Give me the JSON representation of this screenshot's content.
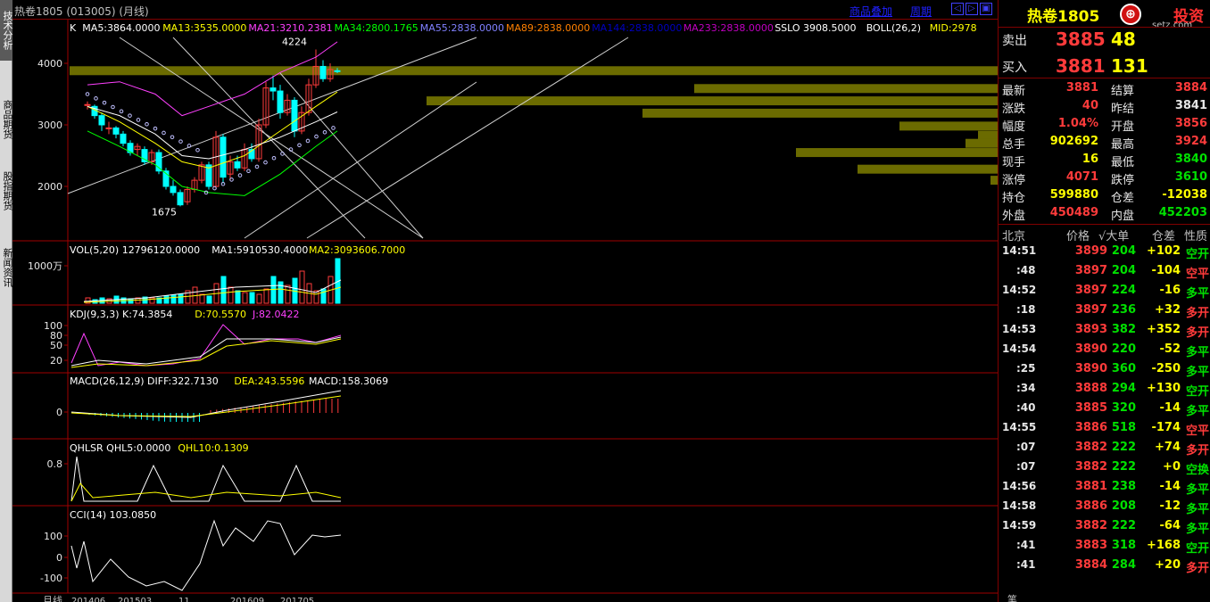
{
  "window": {
    "title": "热卷1805 (013005) (月线)"
  },
  "toolbar": {
    "overlay_label": "商品叠加",
    "period_label": "周期",
    "btn_prev": "◁",
    "btn_next": "▷",
    "btn_close": "▣"
  },
  "side_tabs": [
    {
      "label": "技术分析",
      "active": true
    },
    {
      "label": "商品期货",
      "active": false
    },
    {
      "label": "股指期货",
      "active": false
    },
    {
      "label": "新闻资讯",
      "active": false
    }
  ],
  "kline": {
    "legend": [
      {
        "text": "K",
        "color": "#ffffff"
      },
      {
        "text": "MA5:3864.0000",
        "color": "#ffffff"
      },
      {
        "text": "MA13:3535.0000",
        "color": "#ffff00"
      },
      {
        "text": "MA21:3210.2381",
        "color": "#ff40ff"
      },
      {
        "text": "MA34:2800.1765",
        "color": "#00ff00"
      },
      {
        "text": "MA55:2838.0000",
        "color": "#8080ff"
      },
      {
        "text": "MA89:2838.0000",
        "color": "#ff8000"
      },
      {
        "text": "MA144:2838.0000",
        "color": "#0000c0"
      },
      {
        "text": "MA233:2838.0000",
        "color": "#c000c0"
      },
      {
        "text": "SSLO  3908.5000",
        "color": "#ffffff"
      },
      {
        "text": "BOLL(26,2)",
        "color": "#ffffff"
      },
      {
        "text": "MID:2978",
        "color": "#ffff00"
      }
    ],
    "y_ticks": [
      "4000",
      "3000",
      "2000"
    ],
    "high_label": "4224",
    "low_label": "1675"
  },
  "vol": {
    "legend": [
      {
        "text": "VOL(5,20)  12796120.0000",
        "color": "#ffffff"
      },
      {
        "text": "MA1:5910530.4000",
        "color": "#ffffff"
      },
      {
        "text": "MA2:3093606.7000",
        "color": "#ffff00"
      }
    ],
    "y_ticks": [
      "1000万"
    ]
  },
  "kdj": {
    "legend": [
      {
        "text": "KDJ(9,3,3)  K:74.3854",
        "color": "#ffffff"
      },
      {
        "text": "D:70.5570",
        "color": "#ffff00"
      },
      {
        "text": "J:82.0422",
        "color": "#ff40ff"
      }
    ],
    "y_ticks": [
      "100",
      "80",
      "50",
      "20"
    ]
  },
  "macd": {
    "legend": [
      {
        "text": "MACD(26,12,9)  DIFF:322.7130",
        "color": "#ffffff"
      },
      {
        "text": "DEA:243.5596",
        "color": "#ffff00"
      },
      {
        "text": "MACD:158.3069",
        "color": "#ffffff"
      }
    ],
    "y_ticks": [
      "0"
    ]
  },
  "qhlsr": {
    "legend": [
      {
        "text": "QHLSR  QHL5:0.0000",
        "color": "#ffffff"
      },
      {
        "text": "QHL10:0.1309",
        "color": "#ffff00"
      }
    ],
    "y_ticks": [
      "0.8"
    ]
  },
  "cci": {
    "legend": [
      {
        "text": "CCI(14)  103.0850",
        "color": "#ffffff"
      }
    ],
    "y_ticks": [
      "100",
      "0",
      "-100"
    ]
  },
  "x_axis": {
    "period_label": "月线",
    "ticks": [
      "201406",
      "201503",
      "11",
      "201609",
      "201705"
    ]
  },
  "quote": {
    "name": "热卷1805",
    "brand": "投资",
    "brand_url": "setz.com",
    "ask_label": "卖出",
    "ask_price": "3885",
    "ask_vol": "48",
    "bid_label": "买入",
    "bid_price": "3881",
    "bid_vol": "131",
    "stats": [
      [
        "最新",
        "3881",
        "red",
        "结算",
        "3884",
        "red"
      ],
      [
        "涨跌",
        "40",
        "red",
        "昨结",
        "3841",
        "white"
      ],
      [
        "幅度",
        "1.04%",
        "red",
        "开盘",
        "3856",
        "red"
      ],
      [
        "总手",
        "902692",
        "yellow",
        "最高",
        "3924",
        "red"
      ],
      [
        "现手",
        "16",
        "yellow",
        "最低",
        "3840",
        "green"
      ],
      [
        "涨停",
        "4071",
        "red",
        "跌停",
        "3610",
        "green"
      ],
      [
        "持仓",
        "599880",
        "yellow",
        "仓差",
        "-12038",
        "yellow"
      ],
      [
        "外盘",
        "450489",
        "red",
        "内盘",
        "452203",
        "green"
      ]
    ],
    "ticks_header": [
      "北京",
      "价格",
      "√大单",
      "仓差",
      "性质"
    ],
    "ticks": [
      [
        "14:51",
        "3899",
        "204",
        "+102",
        "空开",
        "green"
      ],
      [
        ":48",
        "3897",
        "204",
        "-104",
        "空平",
        "red"
      ],
      [
        "14:52",
        "3897",
        "224",
        "-16",
        "多平",
        "green"
      ],
      [
        ":18",
        "3897",
        "236",
        "+32",
        "多开",
        "red"
      ],
      [
        "14:53",
        "3893",
        "382",
        "+352",
        "多开",
        "red"
      ],
      [
        "14:54",
        "3890",
        "220",
        "-52",
        "多平",
        "green"
      ],
      [
        ":25",
        "3890",
        "360",
        "-250",
        "多平",
        "green"
      ],
      [
        ":34",
        "3888",
        "294",
        "+130",
        "空开",
        "green"
      ],
      [
        ":40",
        "3885",
        "320",
        "-14",
        "多平",
        "green"
      ],
      [
        "14:55",
        "3886",
        "518",
        "-174",
        "空平",
        "red"
      ],
      [
        ":07",
        "3882",
        "222",
        "+74",
        "多开",
        "red"
      ],
      [
        ":07",
        "3882",
        "222",
        "+0",
        "空换",
        "green"
      ],
      [
        "14:56",
        "3881",
        "238",
        "-14",
        "多平",
        "green"
      ],
      [
        "14:58",
        "3886",
        "208",
        "-12",
        "多平",
        "green"
      ],
      [
        "14:59",
        "3882",
        "222",
        "-64",
        "多平",
        "green"
      ],
      [
        ":41",
        "3883",
        "318",
        "+168",
        "空开",
        "green"
      ],
      [
        ":41",
        "3884",
        "284",
        "+20",
        "多开",
        "red"
      ]
    ],
    "footer_label": "笔"
  }
}
